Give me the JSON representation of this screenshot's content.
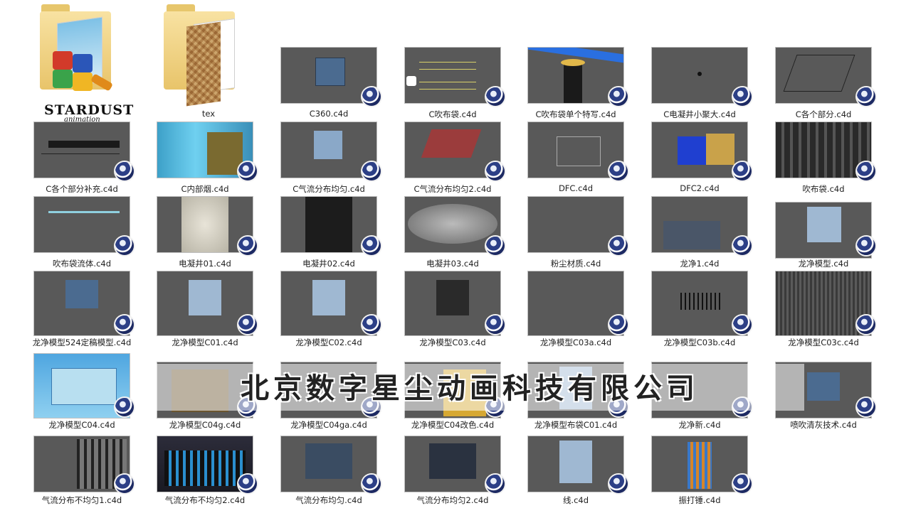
{
  "watermark": {
    "text": "北京数字星尘动画科技有限公司"
  },
  "logo": {
    "name": "STARDUST",
    "sub": "animation"
  },
  "folders": [
    {
      "name": ""
    },
    {
      "name": "tex"
    }
  ],
  "files": [
    "C360.c4d",
    "C吹布袋.c4d",
    "C吹布袋单个特写.c4d",
    "C电凝井小聚大.c4d",
    "C各个部分.c4d",
    "C各个部分补充.c4d",
    "C内部烟.c4d",
    "C气流分布均匀.c4d",
    "C气流分布均匀2.c4d",
    "DFC.c4d",
    "DFC2.c4d",
    "吹布袋.c4d",
    "吹布袋流体.c4d",
    "电凝井01.c4d",
    "电凝井02.c4d",
    "电凝井03.c4d",
    "粉尘材质.c4d",
    "龙净1.c4d",
    "龙净模型.c4d",
    "龙净模型524定稿模型.c4d",
    "龙净模型C01.c4d",
    "龙净模型C02.c4d",
    "龙净模型C03.c4d",
    "龙净模型C03a.c4d",
    "龙净模型C03b.c4d",
    "龙净模型C03c.c4d",
    "龙净模型C04.c4d",
    "龙净模型C04g.c4d",
    "龙净模型C04ga.c4d",
    "龙净模型C04改色.c4d",
    "龙净模型布袋C01.c4d",
    "龙净新.c4d",
    "喷吹清灰技术.c4d",
    "气流分布不均匀1.c4d",
    "气流分布不均匀2.c4d",
    "气流分布均匀.c4d",
    "气流分布均匀2.c4d",
    "线.c4d",
    "振打锤.c4d"
  ]
}
